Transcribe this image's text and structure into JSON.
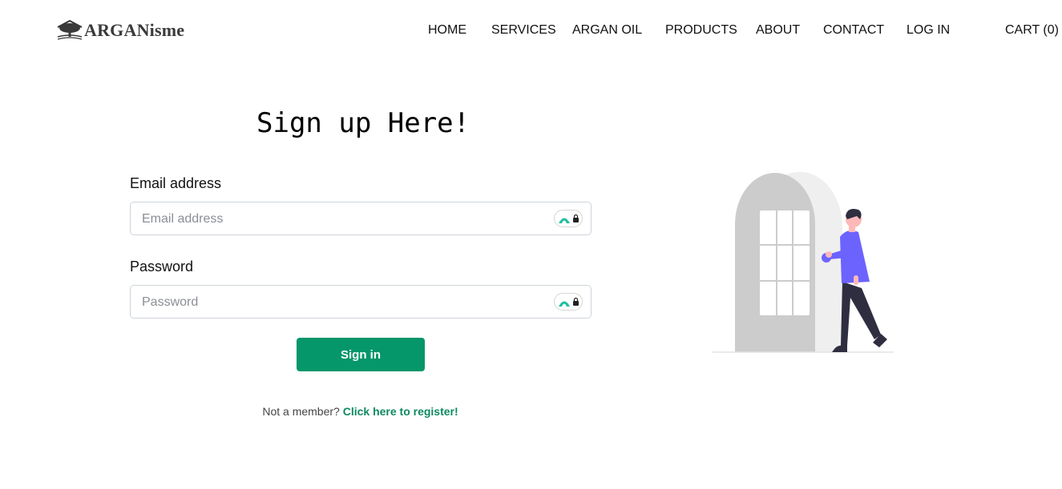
{
  "brand": {
    "name": "ARGANisme"
  },
  "nav": {
    "items": [
      {
        "label": "HOME"
      },
      {
        "label": "SERVICES"
      },
      {
        "label": "ARGAN OIL"
      },
      {
        "label": "PRODUCTS"
      },
      {
        "label": "ABOUT"
      },
      {
        "label": "CONTACT"
      },
      {
        "label": "LOG IN"
      },
      {
        "label": "CART (0)"
      }
    ]
  },
  "form": {
    "title": "Sign up Here!",
    "email_label": "Email address",
    "email_placeholder": "Email address",
    "email_value": "",
    "password_label": "Password",
    "password_placeholder": "Password",
    "password_value": "",
    "submit_label": "Sign in",
    "register_prompt": "Not a member?",
    "register_link": "Click here to register!"
  },
  "icons": {
    "logo": "argan-tree-logo-icon",
    "password_manager": "password-manager-lock-icon",
    "illustration": "person-entering-door-illustration"
  },
  "colors": {
    "accent": "#059669",
    "link": "#0e8a5f",
    "illustration_purple": "#6c63ff"
  }
}
